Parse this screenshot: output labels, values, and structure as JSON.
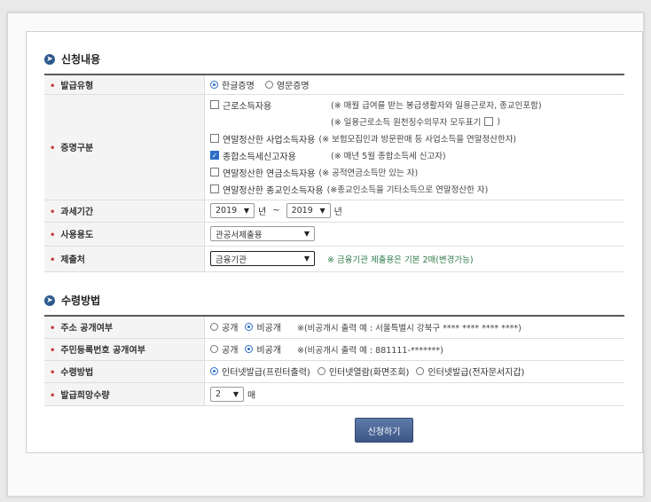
{
  "section1": {
    "title": "신청내용",
    "issue_type": {
      "label": "발급유형",
      "options": [
        "한글증명",
        "영문증명"
      ],
      "selected_index": 0
    },
    "cert_type": {
      "label": "증명구분",
      "items": [
        {
          "name": "근로소득자용",
          "note": "(※ 매월 급여를 받는 봉급생활자와 일용근로자, 종교인포함)",
          "checked": false
        },
        {
          "name": "연말정산한 사업소득자용",
          "note": "(※ 보험모집인과 방문판매 등 사업소득을 연말정산한자)",
          "checked": false
        },
        {
          "name": "종합소득세신고자용",
          "note": "(※ 매년 5월 종합소득세 신고자)",
          "checked": true
        },
        {
          "name": "연말정산한 연금소득자용",
          "note": "(※ 공적연금소득만 있는 자)",
          "checked": false
        },
        {
          "name": "연말정산한 종교인소득자용",
          "note": "(※종교인소득을 기타소득으로 연말정산한 자)",
          "checked": false
        }
      ],
      "sub_note": "(※ 일용근로소득 원천징수의무자 모두표기",
      "sub_note_close": ")"
    },
    "tax_period": {
      "label": "과세기간",
      "from": "2019",
      "to": "2019",
      "unit": "년",
      "sep": "~"
    },
    "purpose": {
      "label": "사용용도",
      "value": "관공서제출용"
    },
    "submit_to": {
      "label": "제출처",
      "value": "금융기관",
      "note": "※ 금융기관 제출용은 기본 2매(변경가능)"
    }
  },
  "section2": {
    "title": "수령방법",
    "address_disclose": {
      "label": "주소 공개여부",
      "options": [
        "공개",
        "비공개"
      ],
      "selected_index": 1,
      "note": "※(비공개시 출력 예 : 서울특별시 강북구 **** **** **** ****)"
    },
    "rrn_disclose": {
      "label": "주민등록번호 공개여부",
      "options": [
        "공개",
        "비공개"
      ],
      "selected_index": 1,
      "note": "※(비공개시 출력 예 : 881111-*******)"
    },
    "receive_method": {
      "label": "수령방법",
      "options": [
        "인터넷발급(프린터출력)",
        "인터넷열람(화면조회)",
        "인터넷발급(전자문서지갑)"
      ],
      "selected_index": 0
    },
    "copies": {
      "label": "발급희망수량",
      "value": "2",
      "unit": "매"
    }
  },
  "submit_label": "신청하기",
  "colors": {
    "accent": "#2d6dc7",
    "bullet": "#c53a3a",
    "button": "#3c5687",
    "note_green": "#2f7b4a"
  }
}
